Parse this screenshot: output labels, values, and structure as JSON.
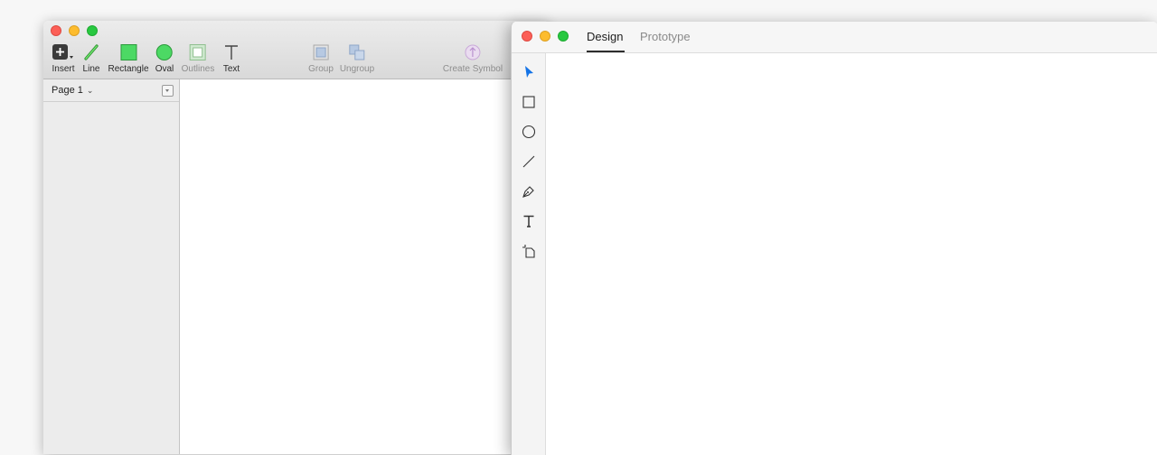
{
  "sketch": {
    "toolbar": {
      "insert": "Insert",
      "line": "Line",
      "rectangle": "Rectangle",
      "oval": "Oval",
      "outlines": "Outlines",
      "text": "Text",
      "group": "Group",
      "ungroup": "Ungroup",
      "create_symbol": "Create Symbol"
    },
    "sidebar": {
      "page_label": "Page 1"
    }
  },
  "xd": {
    "tabs": [
      {
        "label": "Design",
        "active": true
      },
      {
        "label": "Prototype",
        "active": false
      }
    ],
    "tools": [
      "select-arrow-icon",
      "rectangle-icon",
      "ellipse-icon",
      "line-icon",
      "pen-icon",
      "text-icon",
      "artboard-icon"
    ]
  },
  "colors": {
    "close": "#fc5f57",
    "minimize": "#fdbc2e",
    "zoom": "#28c840",
    "select_tool": "#1473e6",
    "shape_green": "#4cd964"
  }
}
